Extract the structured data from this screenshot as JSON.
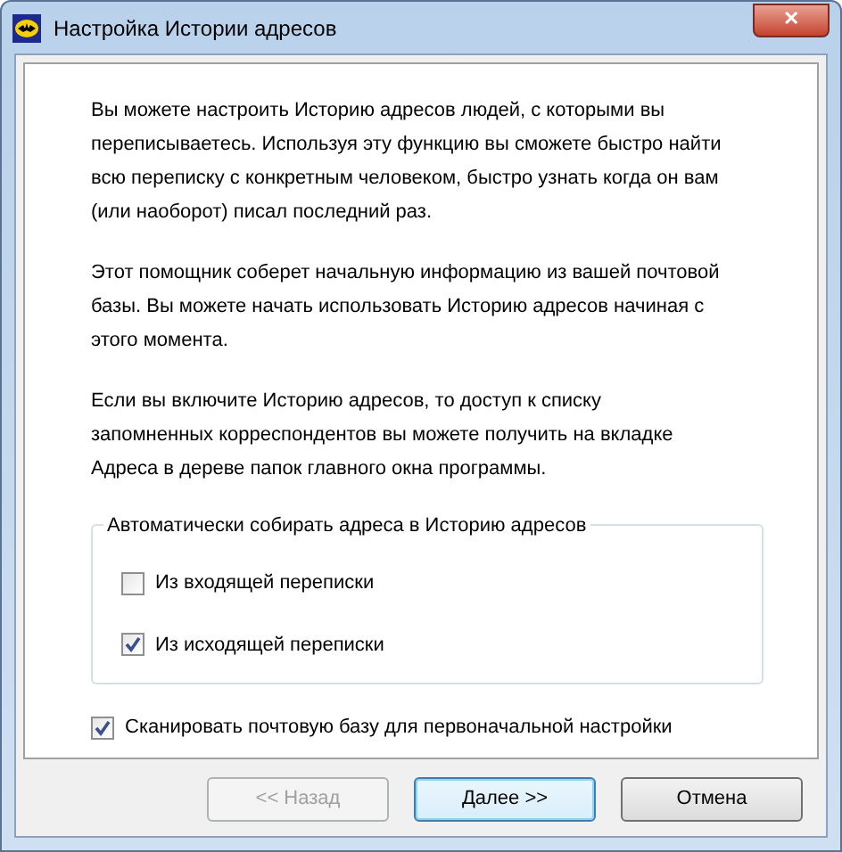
{
  "window": {
    "title": "Настройка Истории адресов",
    "close": "✕"
  },
  "paragraphs": [
    "Вы можете настроить Историю адресов людей, с которыми вы переписываетесь. Используя эту функцию вы сможете быстро найти всю переписку с конкретным человеком, быстро узнать когда он вам (или наоборот) писал последний раз.",
    "Этот помощник соберет начальную информацию из вашей почтовой базы. Вы можете начать использовать Историю адресов начиная с этого момента.",
    "Если вы включите Историю адресов, то доступ к списку запомненных корреспондентов вы можете получить на вкладке Адреса в дереве папок главного окна программы."
  ],
  "group": {
    "title": "Автоматически собирать адреса в Историю адресов",
    "options": [
      {
        "label": "Из входящей переписки",
        "checked": false
      },
      {
        "label": "Из исходящей переписки",
        "checked": true
      }
    ]
  },
  "scan": {
    "label": "Сканировать почтовую базу для первоначальной настройки",
    "checked": true
  },
  "buttons": [
    {
      "label": "<< Назад",
      "disabled": true,
      "default": false
    },
    {
      "label": "Далее >>",
      "disabled": false,
      "default": true
    },
    {
      "label": "Отмена",
      "disabled": false,
      "default": false
    }
  ]
}
